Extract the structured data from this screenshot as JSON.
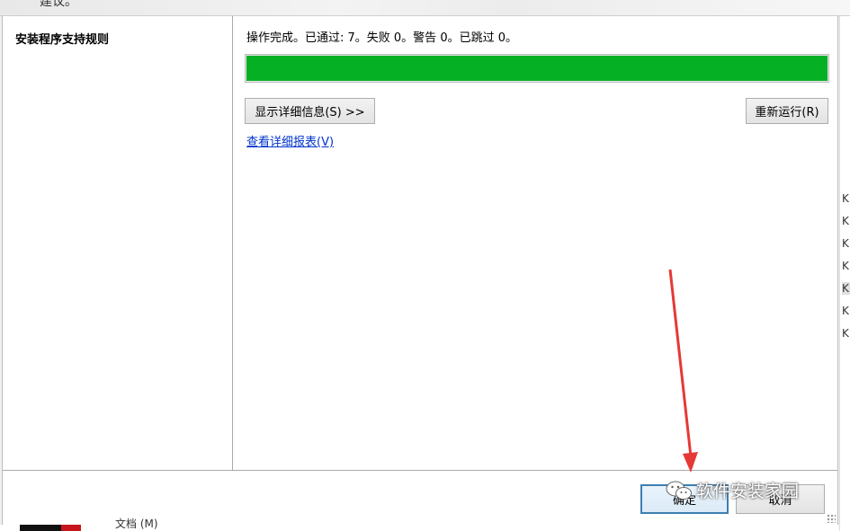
{
  "header": {
    "title_cut": "建议。"
  },
  "left_panel": {
    "step": "安装程序支持规则"
  },
  "main": {
    "status": "操作完成。已通过: 7。失败 0。警告 0。已跳过 0。",
    "progress_percent": 100,
    "details_button": "显示详细信息(S) >>",
    "rerun_button": "重新运行(R)",
    "report_link": "查看详细报表(V)"
  },
  "footer": {
    "ok_button": "确定",
    "cancel_button": "取消"
  },
  "watermark": {
    "text": "软件安装家园",
    "icon": "wechat-icon"
  },
  "background_window": {
    "right_items": [
      "KI",
      "KI",
      "KI",
      "KI",
      "KI",
      "KI",
      "KI"
    ],
    "bottom_text": "文档 (M)"
  },
  "colors": {
    "progress_fill": "#06b025",
    "link": "#0033cc",
    "arrow": "#e53935",
    "ok_border": "#3c7fb1"
  }
}
